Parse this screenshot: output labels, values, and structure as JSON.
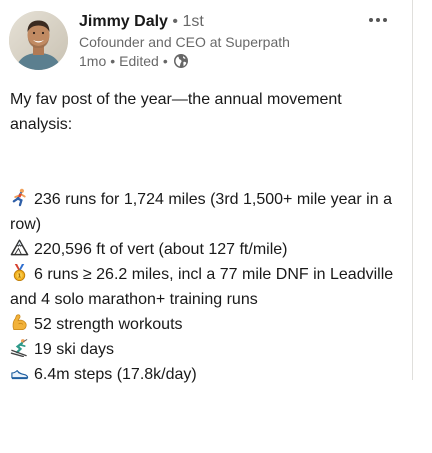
{
  "author": {
    "name": "Jimmy Daly",
    "separator": "•",
    "degree": "1st",
    "headline": "Cofounder and CEO at Superpath",
    "time": "1mo",
    "edited": "Edited",
    "meta_separator": "•",
    "visibility_icon": "globe-icon"
  },
  "menu": {
    "icon": "more-horizontal-icon"
  },
  "post": {
    "intro": "My fav post of the year—the annual movement analysis:",
    "stats": [
      {
        "icon": "running-person-icon",
        "text": "236 runs for 1,724 miles (3rd 1,500+ mile year in a row)"
      },
      {
        "icon": "mountain-icon",
        "text": "220,596 ft of vert (about 127 ft/mile)"
      },
      {
        "icon": "medal-icon",
        "text": "6 runs ≥ 26.2 miles, incl a 77 mile DNF in Leadville and 4 solo marathon+ training runs"
      },
      {
        "icon": "flexed-biceps-icon",
        "text": "52 strength workouts"
      },
      {
        "icon": "skier-icon",
        "text": "19 ski days"
      },
      {
        "icon": "running-shoe-icon",
        "text": "6.4m steps (17.8k/day)"
      }
    ]
  }
}
